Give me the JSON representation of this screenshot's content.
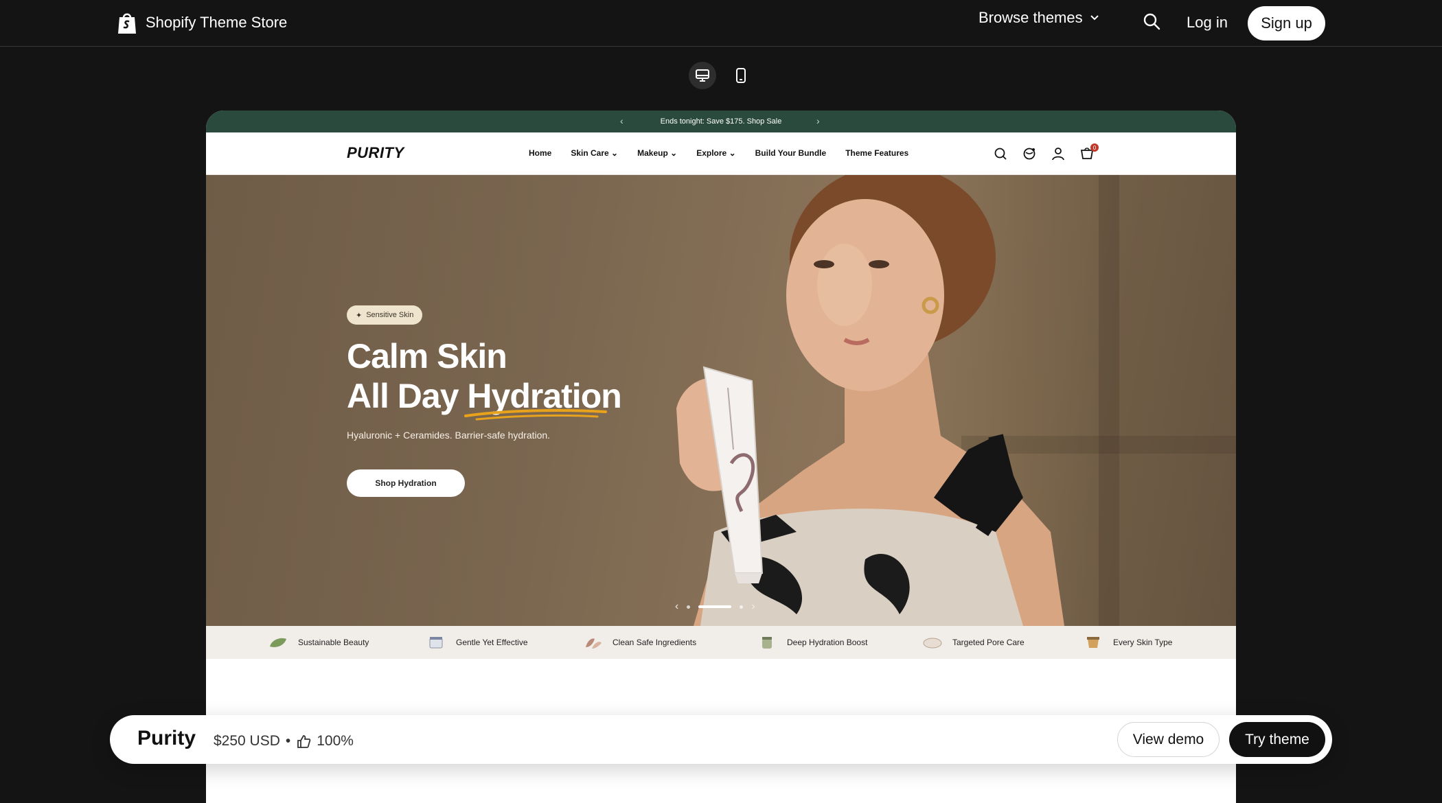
{
  "store": {
    "brand": "Shopify Theme Store",
    "browse_label": "Browse themes",
    "login_label": "Log in",
    "signup_label": "Sign up"
  },
  "device_toggle": {
    "options": [
      "desktop",
      "mobile"
    ],
    "selected": "desktop"
  },
  "preview": {
    "announcement": "Ends tonight: Save $175. Shop Sale",
    "logo": "PURITY",
    "menu": [
      "Home",
      "Skin Care",
      "Makeup",
      "Explore",
      "Build Your Bundle",
      "Theme Features"
    ],
    "cart_count": "0",
    "hero": {
      "badge": "Sensitive Skin",
      "headline_line1": "Calm Skin",
      "headline_line2_a": "All Day",
      "headline_line2_b": "Hydration",
      "subtitle": "Hyaluronic + Ceramides. Barrier-safe hydration.",
      "cta": "Shop Hydration",
      "accent": "#e8a21c"
    },
    "features": [
      "Sustainable Beauty",
      "Gentle Yet Effective",
      "Clean Safe Ingredients",
      "Deep Hydration Boost",
      "Targeted Pore Care",
      "Every Skin Type"
    ]
  },
  "theme": {
    "name": "Purity",
    "price": "$250 USD",
    "rating": "100%",
    "view_demo": "View demo",
    "try_theme": "Try theme"
  }
}
